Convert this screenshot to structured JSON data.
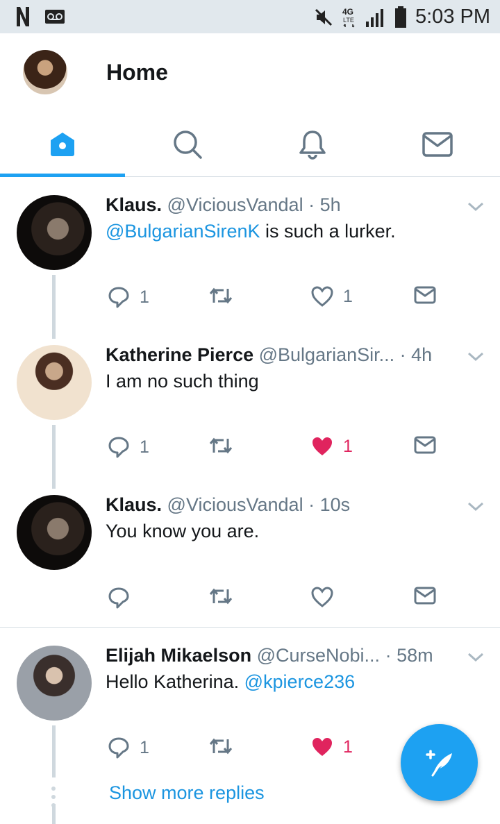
{
  "status_bar": {
    "time": "5:03 PM",
    "network": "4G LTE"
  },
  "header": {
    "title": "Home"
  },
  "tabs": [
    {
      "name": "home-tab",
      "icon": "home-icon",
      "selected": true
    },
    {
      "name": "search-tab",
      "icon": "search-icon",
      "selected": false
    },
    {
      "name": "notifications-tab",
      "icon": "bell-icon",
      "selected": false
    },
    {
      "name": "messages-tab",
      "icon": "mail-icon",
      "selected": false
    }
  ],
  "tweets": [
    {
      "name": "Klaus.",
      "handle": "@ViciousVandal",
      "time": "· 5h",
      "text_link": "@BulgarianSirenK",
      "text": " is such a lurker.",
      "replies": "1",
      "likes": "1",
      "liked": false
    },
    {
      "name": "Katherine Pierce",
      "handle": "@BulgarianSir...",
      "time": "· 4h",
      "text_link": "",
      "text": "I am no such thing",
      "replies": "1",
      "likes": "1",
      "liked": true
    },
    {
      "name": "Klaus.",
      "handle": "@ViciousVandal",
      "time": "· 10s",
      "text_link": "",
      "text": "You know you are.",
      "replies": "",
      "likes": "",
      "liked": false
    },
    {
      "name": "Elijah Mikaelson",
      "handle": "@CurseNobi...",
      "time": "· 58m",
      "text_pre": "Hello Katherina. ",
      "text_link": "@kpierce236",
      "replies": "1",
      "likes": "1",
      "liked": true
    }
  ],
  "show_more": "Show more replies",
  "colors": {
    "accent": "#1da1f2",
    "like": "#e0245e",
    "text_secondary": "#657786"
  }
}
